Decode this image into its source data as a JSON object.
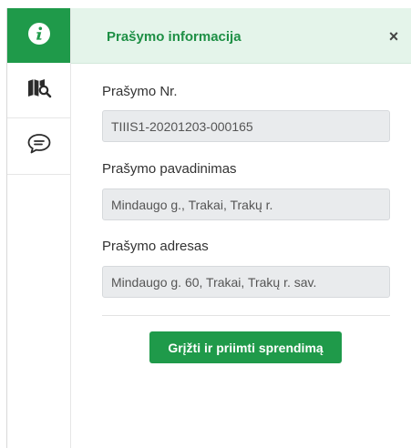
{
  "sidebar": {
    "items": [
      {
        "icon": "info-icon",
        "active": true
      },
      {
        "icon": "map-search-icon",
        "active": false
      },
      {
        "icon": "chat-bubble-icon",
        "active": false
      }
    ]
  },
  "panel": {
    "title": "Prašymo informacija",
    "close_label": "×"
  },
  "fields": [
    {
      "label": "Prašymo Nr.",
      "value": "TIIIS1-20201203-000165"
    },
    {
      "label": "Prašymo pavadinimas",
      "value": "Mindaugo g., Trakai, Trakų r."
    },
    {
      "label": "Prašymo adresas",
      "value": "Mindaugo g. 60, Trakai, Trakų r. sav."
    }
  ],
  "actions": {
    "primary_label": "Grįžti ir priimti sprendimą"
  },
  "colors": {
    "accent": "#1f9a4a",
    "header_bg": "#e4f4ea",
    "title_text": "#1e8f45",
    "input_bg": "#e9ebed"
  }
}
